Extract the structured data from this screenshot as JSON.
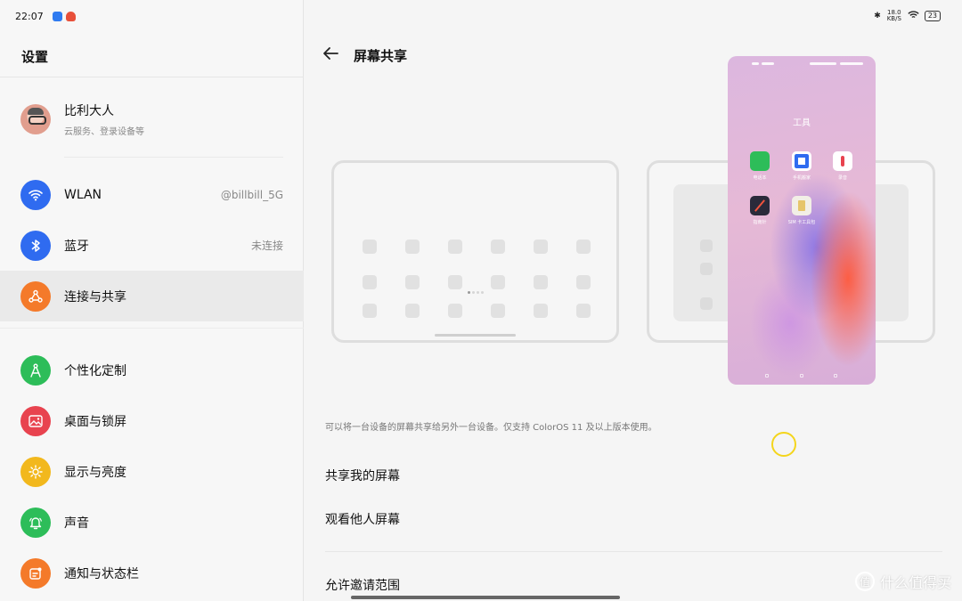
{
  "status_left": {
    "time": "22:07"
  },
  "status_right": {
    "speed": "18.0 KB/S",
    "battery": "23"
  },
  "left": {
    "title": "设置",
    "profile": {
      "name": "比利大人",
      "subtitle": "云服务、登录设备等"
    },
    "items": [
      {
        "label": "WLAN",
        "value": "@billbill_5G",
        "icon": "wifi-icon",
        "color": "#2f6bf0"
      },
      {
        "label": "蓝牙",
        "value": "未连接",
        "icon": "bluetooth-icon",
        "color": "#2f6bf0"
      },
      {
        "label": "连接与共享",
        "value": "",
        "icon": "share-icon",
        "color": "#f47a2a"
      },
      {
        "label": "个性化定制",
        "value": "",
        "icon": "compass-icon",
        "color": "#2dbd59"
      },
      {
        "label": "桌面与锁屏",
        "value": "",
        "icon": "image-icon",
        "color": "#e8434f"
      },
      {
        "label": "显示与亮度",
        "value": "",
        "icon": "sun-icon",
        "color": "#f2b81d"
      },
      {
        "label": "声音",
        "value": "",
        "icon": "bell-icon",
        "color": "#2dbd59"
      },
      {
        "label": "通知与状态栏",
        "value": "",
        "icon": "notification-icon",
        "color": "#f47a2a"
      }
    ]
  },
  "right": {
    "title": "屏幕共享",
    "phone": {
      "folder_title": "工具",
      "apps": [
        {
          "label": "电话本",
          "color": "#2dbd59"
        },
        {
          "label": "手机搬家",
          "color": "#ffffff"
        },
        {
          "label": "录音",
          "color": "#ffffff"
        },
        {
          "label": "指南针",
          "color": "#2a2a3a"
        },
        {
          "label": "SIM 卡工具包",
          "color": "#f2efe6"
        }
      ]
    },
    "description": "可以将一台设备的屏幕共享给另外一台设备。仅支持 ColorOS 11 及以上版本使用。",
    "options": {
      "share_my_screen": "共享我的屏幕",
      "watch_others": "观看他人屏幕",
      "invite_scope": "允许邀请范围"
    }
  },
  "watermark": {
    "text": "什么值得买",
    "logo": "值"
  }
}
